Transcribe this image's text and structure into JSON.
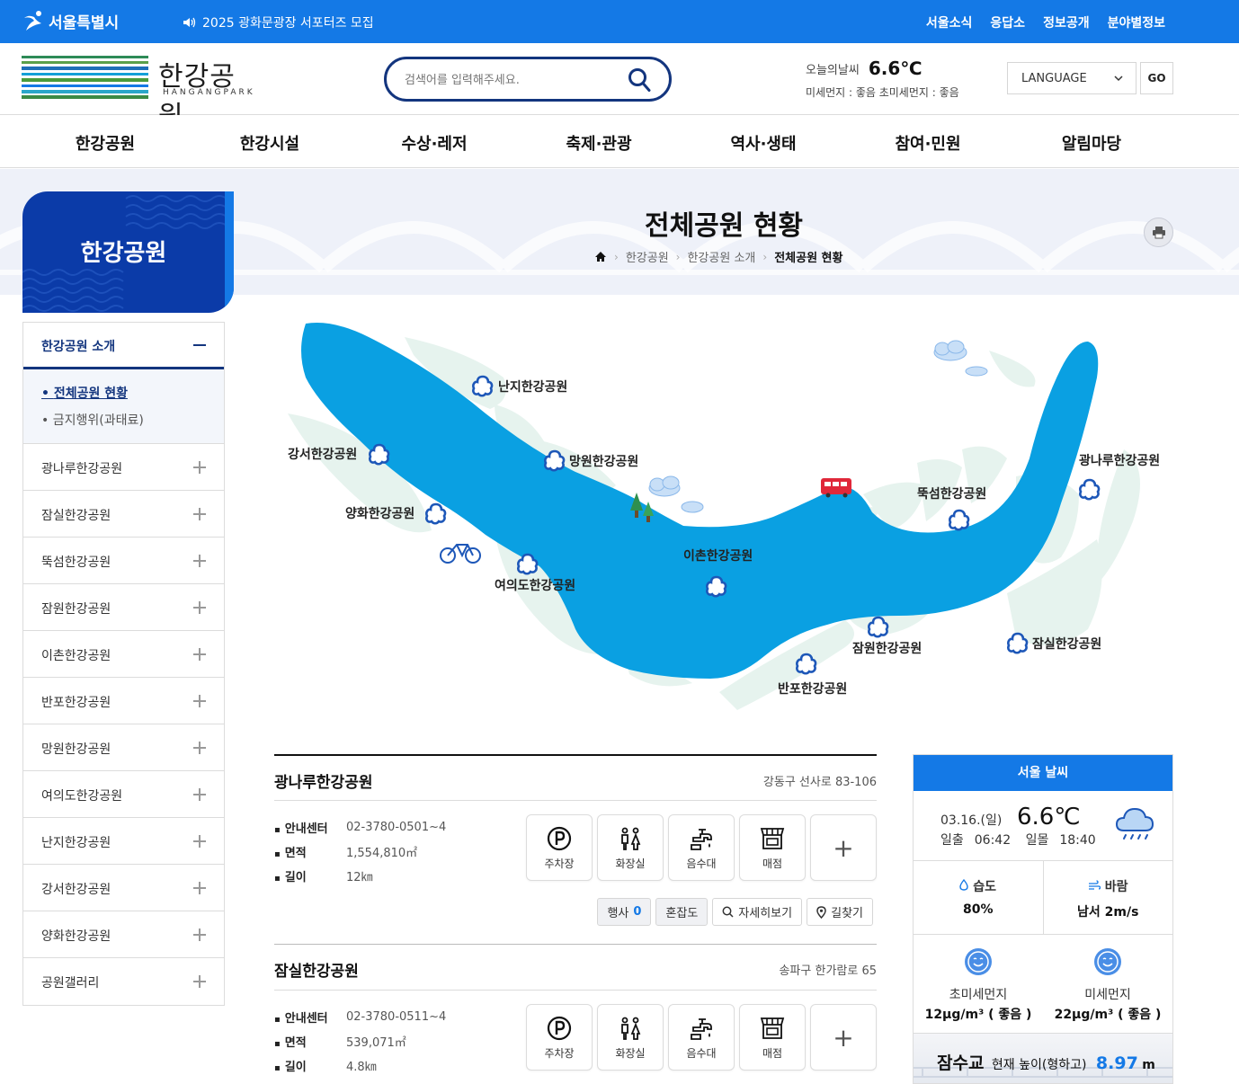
{
  "topbar": {
    "seoul_logo": "서울특별시",
    "notice": "2025 광화문광장 서포터즈 모집",
    "links": [
      "서울소식",
      "응답소",
      "정보공개",
      "분야별정보"
    ]
  },
  "header": {
    "logo_text": "한강공원",
    "logo_sub": "HANGANGPARK",
    "search_placeholder": "검색어를 입력해주세요.",
    "weather_label": "오늘의날씨",
    "weather_temp": "6.6℃",
    "air_quality": "미세먼지 : 좋음   초미세먼지 : 좋음",
    "language_label": "LANGUAGE",
    "go_label": "GO"
  },
  "gnb": [
    "한강공원",
    "한강시설",
    "수상·레저",
    "축제·관광",
    "역사·생태",
    "참여·민원",
    "알림마당"
  ],
  "page": {
    "title": "전체공원 현황",
    "breadcrumb": [
      "한강공원",
      "한강공원 소개",
      "전체공원 현황"
    ]
  },
  "lnb": {
    "title": "한강공원",
    "open_section": "한강공원 소개",
    "sub_items": [
      {
        "label": "전체공원 현황",
        "active": true
      },
      {
        "label": "금지행위(과태료)",
        "active": false
      }
    ],
    "items": [
      "광나루한강공원",
      "잠실한강공원",
      "뚝섬한강공원",
      "잠원한강공원",
      "이촌한강공원",
      "반포한강공원",
      "망원한강공원",
      "여의도한강공원",
      "난지한강공원",
      "강서한강공원",
      "양화한강공원",
      "공원갤러리"
    ]
  },
  "map_labels": {
    "nanji": "난지한강공원",
    "gangseo": "강서한강공원",
    "mangwon": "망원한강공원",
    "yanghwa": "양화한강공원",
    "yeouido": "여의도한강공원",
    "ichon": "이촌한강공원",
    "ttukseom": "뚝섬한강공원",
    "gwangnaru": "광나루한강공원",
    "jamwon": "잠원한강공원",
    "banpo": "반포한강공원",
    "jamsil": "잠실한강공원"
  },
  "parks": [
    {
      "name": "광나루한강공원",
      "address": "강동구 선사로 83-106",
      "info": [
        {
          "k": "안내센터",
          "v": "02-3780-0501~4"
        },
        {
          "k": "면적",
          "v": "1,554,810㎡"
        },
        {
          "k": "길이",
          "v": "12㎞"
        }
      ]
    },
    {
      "name": "잠실한강공원",
      "address": "송파구 한가람로 65",
      "info": [
        {
          "k": "안내센터",
          "v": "02-3780-0511~4"
        },
        {
          "k": "면적",
          "v": "539,071㎡"
        },
        {
          "k": "길이",
          "v": "4.8㎞"
        }
      ]
    }
  ],
  "facilities": {
    "parking": "주차장",
    "toilet": "화장실",
    "water": "음수대",
    "store": "매점",
    "more": "+"
  },
  "actions": {
    "event_label": "행사",
    "event_count": "0",
    "congestion": "혼잡도",
    "detail": "자세히보기",
    "directions": "길찾기"
  },
  "weather": {
    "title": "서울 날씨",
    "date": "03.16.(일)",
    "temp": "6.6℃",
    "sunrise_label": "일출",
    "sunrise": "06:42",
    "sunset_label": "일몰",
    "sunset": "18:40",
    "humidity_label": "습도",
    "humidity": "80%",
    "wind_label": "바람",
    "wind": "남서 2m/s",
    "pm25_label": "초미세먼지",
    "pm25": "12μg/m³ ( 좋음 )",
    "pm10_label": "미세먼지",
    "pm10": "22μg/m³ ( 좋음 )",
    "bridge_name": "잠수교",
    "bridge_label": "현재 높이(형하고)",
    "bridge_height": "8.97",
    "bridge_unit": "m"
  },
  "colors": {
    "primary": "#1479e6",
    "navy": "#13357e",
    "river": "#0d9fdf",
    "land": "#e8f3ef"
  }
}
